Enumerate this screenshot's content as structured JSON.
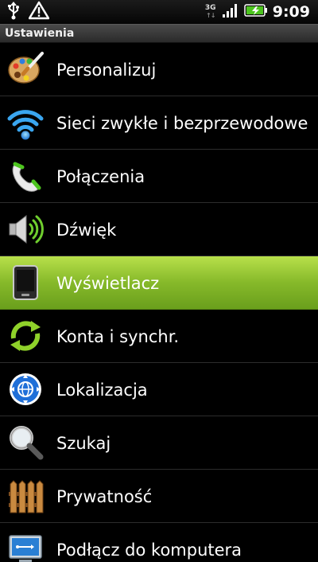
{
  "statusbar": {
    "network": "3G",
    "time": "9:09",
    "left_icons": [
      "usb-icon",
      "warning-icon"
    ],
    "right_icons": [
      "network-3g-icon",
      "signal-icon",
      "battery-charging-icon"
    ]
  },
  "titlebar": {
    "title": "Ustawienia"
  },
  "settings": {
    "items": [
      {
        "label": "Personalizuj",
        "icon": "palette-icon"
      },
      {
        "label": "Sieci zwykłe i bezprzewodowe",
        "icon": "wifi-icon"
      },
      {
        "label": "Połączenia",
        "icon": "phone-icon"
      },
      {
        "label": "Dźwięk",
        "icon": "speaker-icon"
      },
      {
        "label": "Wyświetlacz",
        "icon": "display-icon",
        "selected": true
      },
      {
        "label": "Konta i synchr.",
        "icon": "sync-icon"
      },
      {
        "label": "Lokalizacja",
        "icon": "location-icon"
      },
      {
        "label": "Szukaj",
        "icon": "search-icon"
      },
      {
        "label": "Prywatność",
        "icon": "fence-icon"
      },
      {
        "label": "Podłącz do komputera",
        "icon": "usb-connect-icon"
      }
    ]
  },
  "colors": {
    "selected_start": "#b8e04a",
    "selected_end": "#6a9f1c",
    "background": "#000000"
  }
}
